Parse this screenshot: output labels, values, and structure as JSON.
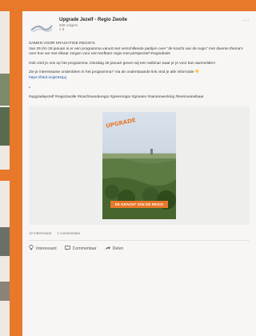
{
  "post": {
    "author": "Upgrade Jezelf - Regio Zwolle",
    "followers": "839 volgers",
    "age": "1 d",
    "more_label": "···",
    "paragraphs": [
      "SAMEN VOOR KRACHTIGE REGIO'S",
      "Van 25 t/m 28 januari is er een programma vanuit met verschillende partijen over \"de kracht van de regio\" met diverse thema's over hoe we met elkaar zorgen voor een leefbare regio met perspectief #regiodeals",
      "Ook vind je ons op het programma. Dinsdag 26 januari geven wij een webinar waar je je voor kan aanmelden!",
      "Zie je interessante onderdelen in het programma? Via de onderstaande link vind je alle informatie"
    ],
    "emoji": "👇",
    "link": "https://lnkd.in/gK84qxj",
    "separator": "•",
    "hashtags": "#upgradejezelf #regiozwolle #krachtvanderegio #greenregio #groeien #samenwerking #leerinvanelkaar",
    "media": {
      "stamp": "UPGRADE",
      "caption": "DE KRACHT VAN DE REGIO"
    },
    "stats": {
      "reactions": "12 interessant",
      "comments": "1 commentaar"
    },
    "actions": {
      "like": "Interessant",
      "comment": "Commentaar",
      "share": "Delen"
    }
  },
  "colors": {
    "accent": "#e8782a",
    "link": "#1f5bb0"
  }
}
